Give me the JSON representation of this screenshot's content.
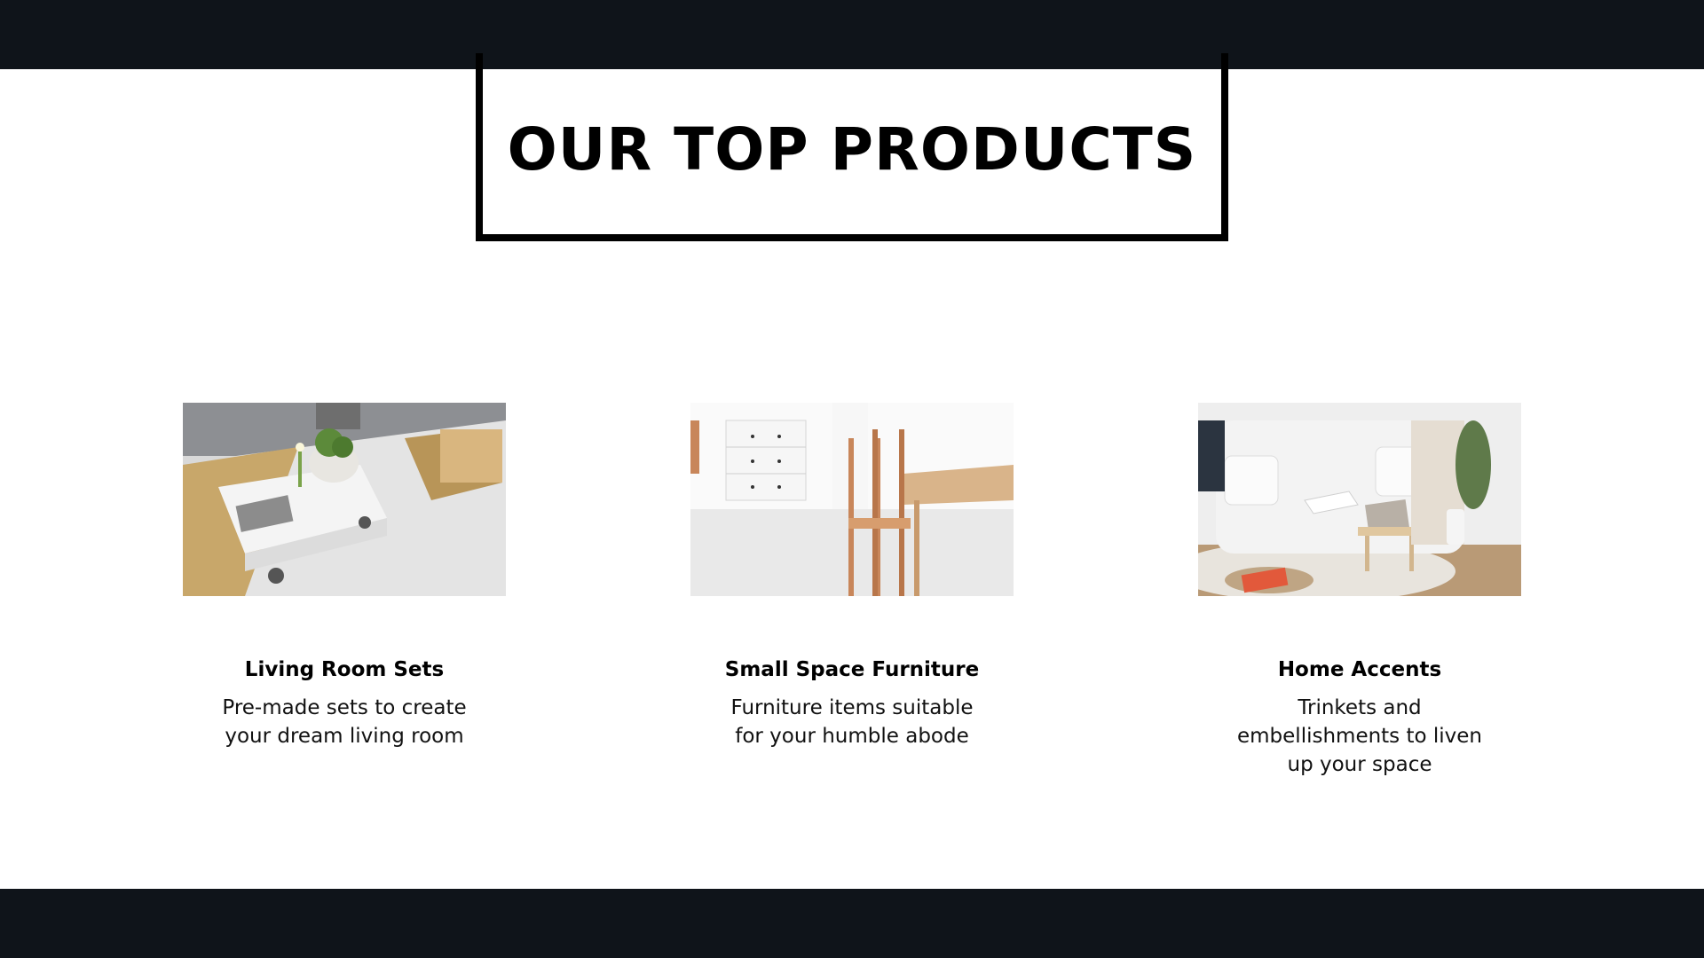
{
  "heading": "OUR TOP PRODUCTS",
  "colors": {
    "band": "#0f141a",
    "border": "#000000",
    "background": "#ffffff"
  },
  "products": [
    {
      "title": "Living Room Sets",
      "description": "Pre-made sets to create your dream living room",
      "image": "living-room-coffee-table-photo"
    },
    {
      "title": "Small Space Furniture",
      "description": "Furniture items suitable for your humble abode",
      "image": "dresser-and-dining-chairs-photo"
    },
    {
      "title": "Home Accents",
      "description": "Trinkets and embellishments to liven up your space",
      "image": "white-sofa-with-pillows-photo"
    }
  ]
}
